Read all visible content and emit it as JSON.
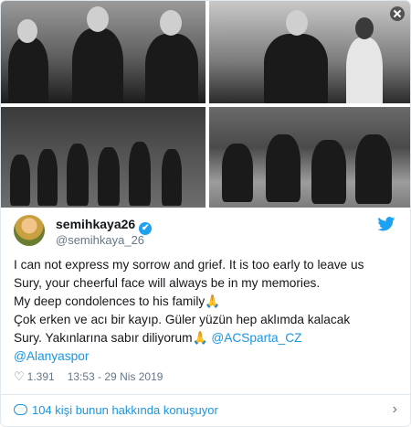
{
  "tweet": {
    "display_name": "semihkaya26",
    "handle": "@semihkaya_26",
    "verified_icon": "✔",
    "lines": [
      {
        "text": "I can not express my sorrow and grief. It is too early to leave us"
      },
      {
        "text": "Sury, your cheerful face will always be in my memories."
      },
      {
        "text": "My deep condolences to his family",
        "emoji": "🙏"
      },
      {
        "text": "Çok erken ve acı bir kayıp. Güler yüzün hep aklımda kalacak"
      },
      {
        "text": "Sury. Yakınlarına sabır diliyorum",
        "emoji": "🙏",
        "mention": "@ACSparta_CZ"
      },
      {
        "mention": "@Alanyaspor"
      }
    ],
    "like_count": "1.391",
    "timestamp": "13:53 - 29 Nis 2019"
  },
  "footer": {
    "conversation_text": "104 kişi bunun hakkında konuşuyor"
  },
  "colors": {
    "link": "#1b95e0",
    "verified": "#1da1f2",
    "muted": "#657786"
  },
  "icons": [
    "close-icon",
    "twitter-bird-icon",
    "verified-icon",
    "heart-icon",
    "comment-icon",
    "chevron-right-icon"
  ]
}
